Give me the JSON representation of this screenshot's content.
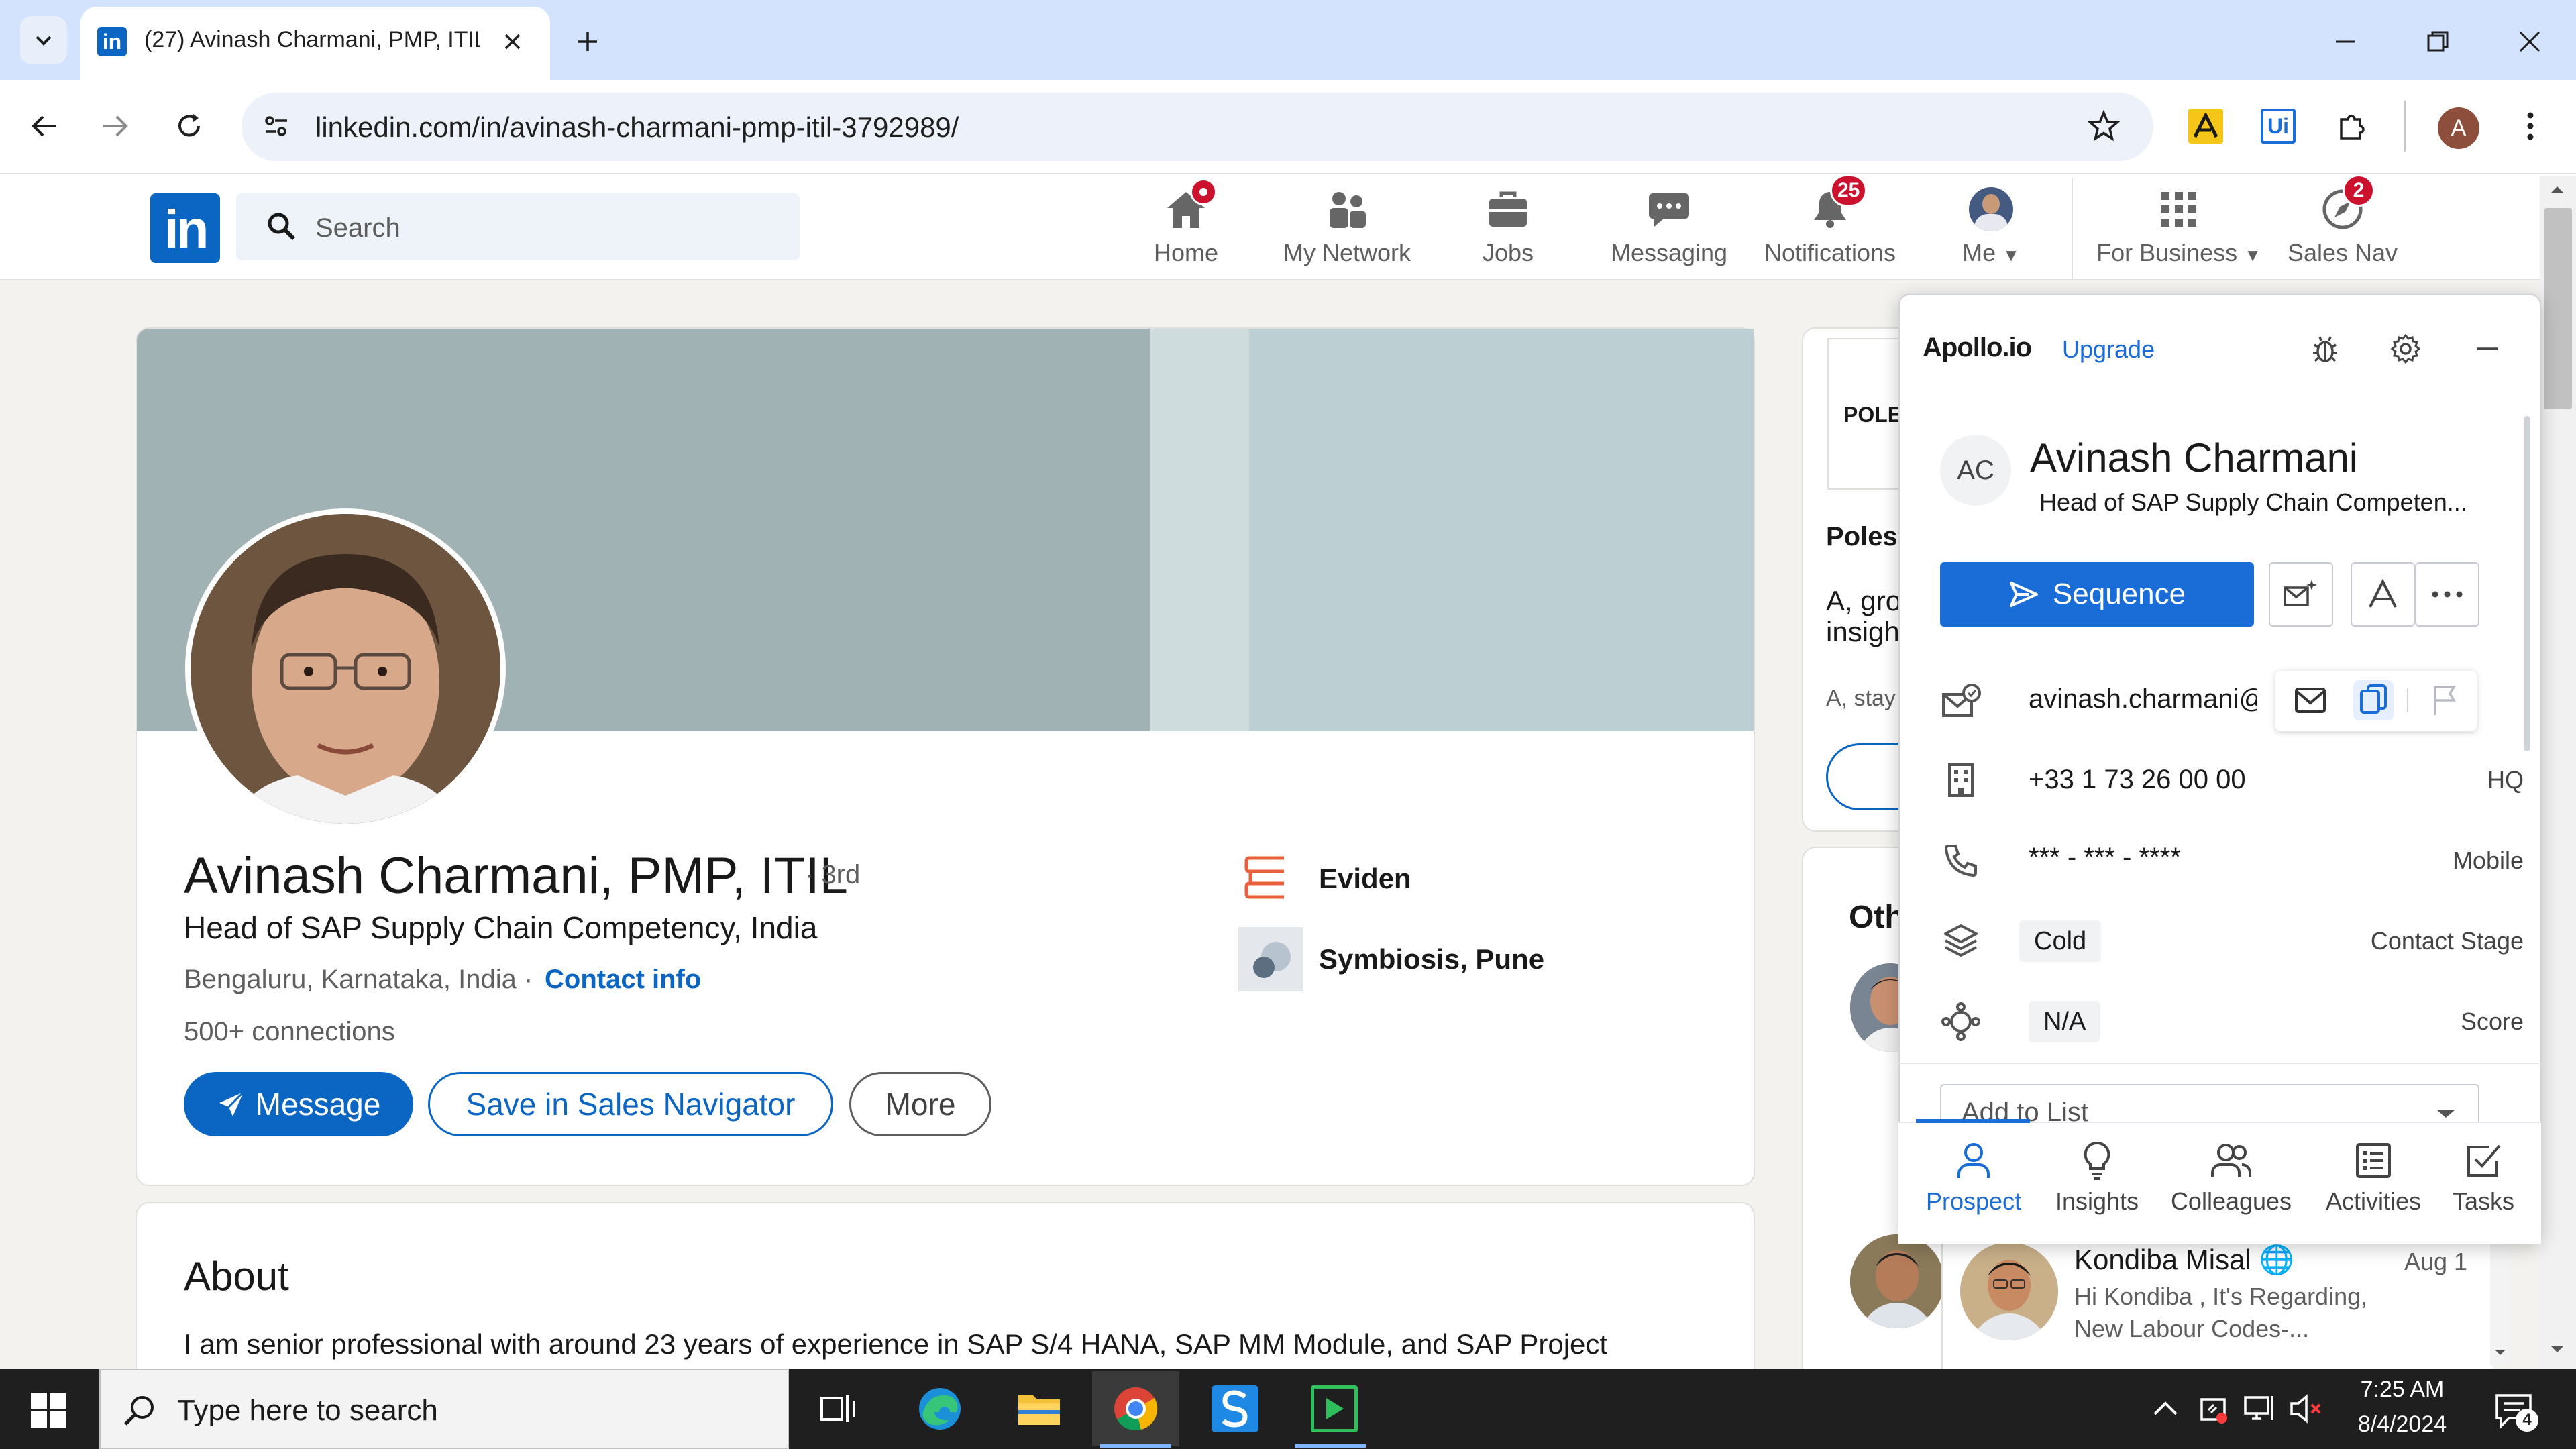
{
  "browser": {
    "tab_title": "(27) Avinash Charmani, PMP, ITIL",
    "url": "linkedin.com/in/avinash-charmani-pmp-itil-3792989/",
    "profile_initial": "A",
    "ext_ui_label": "Ui"
  },
  "linkedin": {
    "logo": "in",
    "search_placeholder": "Search",
    "nav": [
      {
        "label": "Home",
        "icon": "home-icon",
        "badge": ""
      },
      {
        "label": "My Network",
        "icon": "network-icon",
        "badge": ""
      },
      {
        "label": "Jobs",
        "icon": "briefcase-icon",
        "badge": ""
      },
      {
        "label": "Messaging",
        "icon": "messaging-icon",
        "badge": ""
      },
      {
        "label": "Notifications",
        "icon": "bell-icon",
        "badge": "25"
      },
      {
        "label": "Me",
        "icon": "avatar",
        "badge": ""
      },
      {
        "label": "For Business",
        "icon": "grid-icon",
        "badge": ""
      },
      {
        "label": "Sales Nav",
        "icon": "compass-icon",
        "badge": "2"
      }
    ]
  },
  "profile": {
    "name": "Avinash Charmani, PMP, ITIL",
    "degree": "· 3rd",
    "headline": "Head of SAP Supply Chain Competency, India",
    "location": "Bengaluru, Karnataka, India ·",
    "contact_info": "Contact info",
    "connections": "500+ connections",
    "buttons": {
      "message": "Message",
      "save": "Save in Sales Navigator",
      "more": "More"
    },
    "company": "Eviden",
    "school": "Symbiosis, Pune",
    "about_title": "About",
    "about_text": "I am senior professional with around 23 years of experience in SAP S/4 HANA, SAP MM Module, and SAP Project"
  },
  "right_column": {
    "logo_text": "POLE",
    "title": "Polest",
    "desc1": "A, gro",
    "desc2": "insigh",
    "small": "A, stay",
    "other": "Oth"
  },
  "messaging": {
    "name": "Kondiba Misal",
    "date": "Aug 1",
    "preview1": "Hi Kondiba , It's Regarding,",
    "preview2": "New Labour Codes-..."
  },
  "apollo": {
    "logo": "Apollo.io",
    "upgrade": "Upgrade",
    "initials": "AC",
    "name": "Avinash Charmani",
    "title": "Head of SAP Supply Chain Competen...",
    "sequence": "Sequence",
    "email": "avinash.charmani@e",
    "hq_phone": "+33 1 73 26 00 00",
    "hq_label": "HQ",
    "mobile": "*** - *** - ****",
    "mobile_label": "Mobile",
    "stage": "Cold",
    "stage_label": "Contact Stage",
    "score": "N/A",
    "score_label": "Score",
    "add_to_list": "Add to List",
    "tabs": [
      "Prospect",
      "Insights",
      "Colleagues",
      "Activities",
      "Tasks"
    ],
    "accent": "#1a6cd6"
  },
  "taskbar": {
    "search_placeholder": "Type here to search",
    "time": "7:25 AM",
    "date": "8/4/2024",
    "notification_count": "4"
  }
}
